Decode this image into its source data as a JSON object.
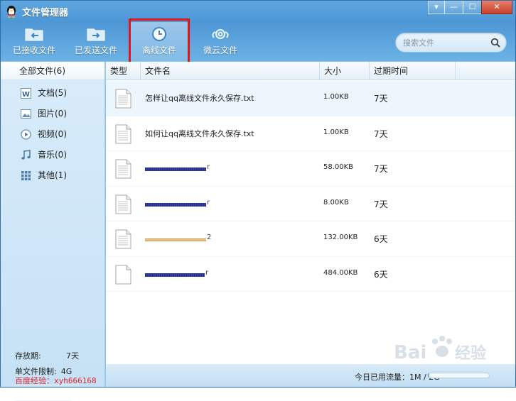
{
  "window": {
    "title": "文件管理器",
    "controls": [
      "▾",
      "—",
      "☐",
      "✕"
    ]
  },
  "toolbar": {
    "received_label": "已接收文件",
    "sent_label": "已发送文件",
    "offline_label": "离线文件",
    "weiyun_label": "微云文件"
  },
  "search": {
    "placeholder": "搜索文件"
  },
  "sidebar": {
    "all_label": "全部文件(6)",
    "items": [
      {
        "label": "文档(5)",
        "icon": "word-doc-icon"
      },
      {
        "label": "图片(0)",
        "icon": "picture-icon"
      },
      {
        "label": "视频(0)",
        "icon": "video-icon"
      },
      {
        "label": "音乐(0)",
        "icon": "music-icon"
      },
      {
        "label": "其他(1)",
        "icon": "other-grid-icon"
      }
    ],
    "retention_label": "存放期:",
    "retention_value": "7天",
    "size_limit_label": "单文件限制:",
    "size_limit_value": "4G",
    "watermark_text": "百度经验：xyh666168"
  },
  "table": {
    "headers": {
      "type": "类型",
      "name": "文件名",
      "size": "大小",
      "expire": "过期时间"
    },
    "rows": [
      {
        "name": "怎样让qq离线文件永久保存.txt",
        "size": "1.00KB",
        "expire": "7天"
      },
      {
        "name": "如何让qq离线文件永久保存.txt",
        "size": "1.00KB",
        "expire": "7天"
      },
      {
        "name": "",
        "tail": "r",
        "size": "58.00KB",
        "expire": "7天"
      },
      {
        "name": "",
        "tail": "r",
        "size": "8.00KB",
        "expire": "7天"
      },
      {
        "name": "",
        "tail": "2",
        "size": "132.00KB",
        "expire": "6天"
      },
      {
        "name": "",
        "tail": "r",
        "size": "484.00KB",
        "expire": "6天"
      }
    ]
  },
  "footer": {
    "traffic_label": "今日已用流量：1M / 2G",
    "traffic_fraction": 0.0005
  },
  "colors": {
    "titlebar": "#4e97d6",
    "highlight": "#e2141c",
    "redact_blue": "#27308c",
    "redact_gold": "#e8c48c"
  }
}
